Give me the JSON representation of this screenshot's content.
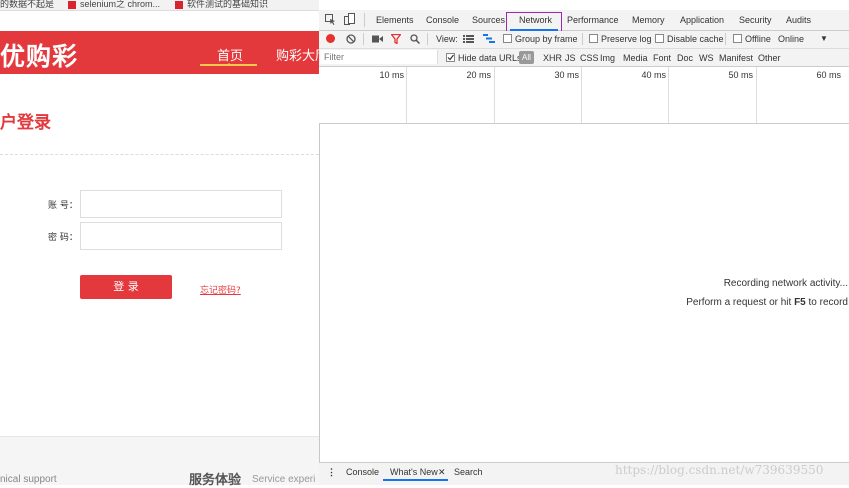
{
  "browser": {
    "bookmarks": [
      {
        "label": "的数据不起是"
      },
      {
        "label": "selenium之 chrom..."
      },
      {
        "label": "软件测试的基础知识"
      }
    ]
  },
  "page": {
    "logo": "优购彩",
    "nav": {
      "home": "首页",
      "lottery_hall": "购彩大厅"
    },
    "login_title": "户登录",
    "account_label": "账 号：",
    "password_label": "密 码：",
    "account_value": "",
    "password_value": "",
    "login_button": "登 录",
    "forgot_link": "忘记密码?",
    "footer_left": "nical support",
    "footer_service": "服务体验",
    "footer_service_en": "Service experi"
  },
  "devtools": {
    "tabs": [
      "Elements",
      "Console",
      "Sources",
      "Network",
      "Performance",
      "Memory",
      "Application",
      "Security",
      "Audits"
    ],
    "active_tab": "Network",
    "toolbar": {
      "view_label": "View:",
      "group_by_frame": "Group by frame",
      "preserve_log": "Preserve log",
      "disable_cache": "Disable cache",
      "offline": "Offline",
      "throttle": "Online"
    },
    "filter": {
      "placeholder": "Filter",
      "hide_data_urls": "Hide data URLs",
      "types": [
        "All",
        "XHR",
        "JS",
        "CSS",
        "Img",
        "Media",
        "Font",
        "Doc",
        "WS",
        "Manifest",
        "Other"
      ]
    },
    "timeline_ticks": [
      "10 ms",
      "20 ms",
      "30 ms",
      "40 ms",
      "50 ms",
      "60 ms"
    ],
    "empty_state": {
      "line1": "Recording network activity...",
      "line2_prefix": "Perform a request or hit ",
      "line2_key": "F5",
      "line2_suffix": " to record"
    },
    "drawer_tabs": [
      "Console",
      "What's New",
      "Search"
    ],
    "active_drawer_tab": "What's New"
  },
  "watermark": "https://blog.csdn.net/w739639550",
  "colors": {
    "brand_red": "#e4393c",
    "network_box": "#9c27b0",
    "accent_blue": "#1a73e8"
  }
}
